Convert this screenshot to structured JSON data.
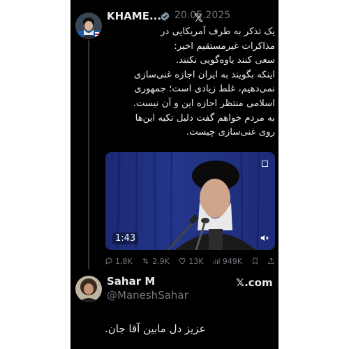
{
  "tweet": {
    "author_name": "KHAME...",
    "date": "20.05.2025",
    "platform_icon": "x-logo-icon",
    "platform_glyph": "𝕏",
    "lines": [
      "یک تذکر به طرف آمریکایی در",
      "مذاکرات غیرمستقیم اخیر:",
      "سعی کنند یاوه‌گویی نکنند.",
      "اینکه بگویند به ایران اجازه غنی‌سازی",
      "نمی‌دهیم، غلط زیادی است؛ جمهوری",
      "اسلامی منتظر اجازه این و آن نیست.",
      "به مردم خواهم گفت دلیل تکیه این‌ها",
      "روی غنی‌سازی چیست."
    ],
    "video_duration": "1:43",
    "stats": {
      "replies": "1,8K",
      "reposts": "2,9K",
      "likes": "13K",
      "views": "949K"
    }
  },
  "reply": {
    "author_name": "Sahar M",
    "handle": "@ManeshSahar",
    "source": "𝕏.com",
    "text": "عزیز دل مابین آقا جان."
  },
  "colors": {
    "background": "#000000",
    "text": "#e7e9ea",
    "muted": "#71767b",
    "verified": "#829aab"
  }
}
